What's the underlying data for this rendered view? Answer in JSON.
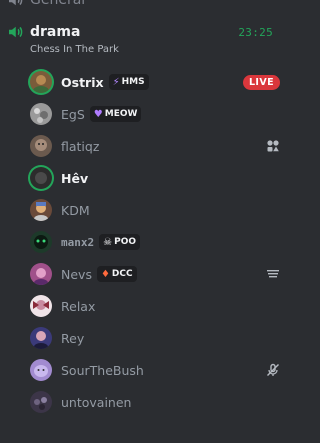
{
  "prev_channel": {
    "name": "General"
  },
  "channel": {
    "name": "drama",
    "timer": "23:25",
    "activity": "Chess In The Park"
  },
  "members": [
    {
      "name": "Ostrix",
      "tag": "HMS",
      "tag_icon": "lightning-icon",
      "live": "LIVE",
      "avatar_color": "#7a5c3a"
    },
    {
      "name": "EgS",
      "tag": "MEOW",
      "tag_icon": "purple-heart-icon",
      "avatar_color": "#9a9a9a"
    },
    {
      "name": "flatiqz",
      "right_icon": "activity-icon",
      "avatar_color": "#6b5a4e"
    },
    {
      "name": "Hêv",
      "avatar_color": "#2c2c2c"
    },
    {
      "name": "KDM",
      "avatar_color": "#6a4a3a"
    },
    {
      "name": "manx2",
      "tag": "POO",
      "tag_icon": "skull-icon",
      "avatar_color": "#1d3a2a"
    },
    {
      "name": "Nevs",
      "tag": "DCC",
      "tag_icon": "fire-icon",
      "right_icon": "app-logo-icon",
      "avatar_color": "#a0508a"
    },
    {
      "name": "Relax",
      "avatar_color": "#c98ba0"
    },
    {
      "name": "Rey",
      "avatar_color": "#3b3a7a"
    },
    {
      "name": "SourTheBush",
      "right_icon": "muted-mic-icon",
      "avatar_color": "#a28bd0"
    },
    {
      "name": "untovainen",
      "avatar_color": "#3c3548"
    }
  ]
}
